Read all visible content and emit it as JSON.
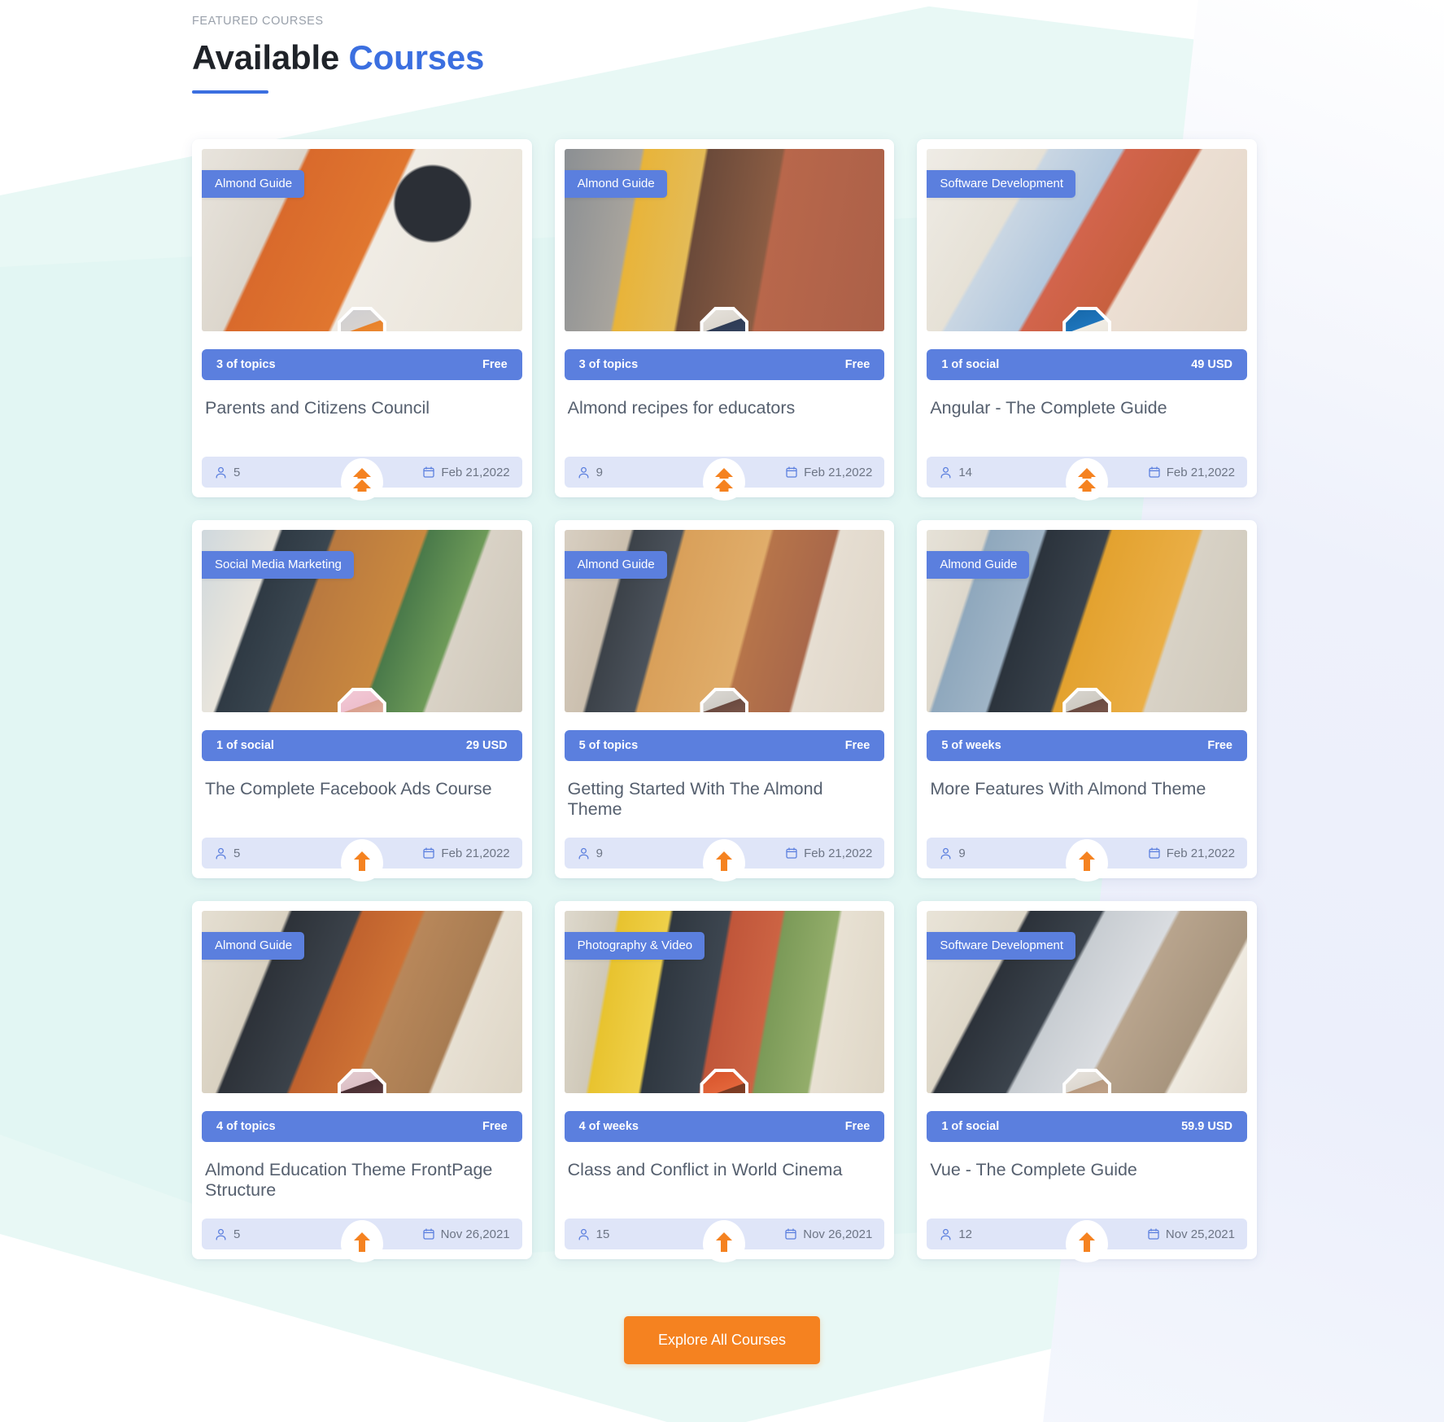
{
  "header": {
    "eyebrow": "FEATURED COURSES",
    "title_plain": "Available ",
    "title_accent": "Courses"
  },
  "colors": {
    "accent_blue": "#3b6fe0",
    "badge_blue": "#5b7fde",
    "orange": "#f58220",
    "footer_bg": "#dfe5f8",
    "mint_bg": "#e4f7f3",
    "title_text": "#555f6e"
  },
  "cards": [
    {
      "category": "Almond Guide",
      "lessons": "3 of topics",
      "price": "Free",
      "title": "Parents and Citizens Council",
      "students": "5",
      "date": "Feb 21,2022",
      "photo_class": "ph-1",
      "avatar_class": "av-1",
      "level_icon": "double-arrow-up-icon"
    },
    {
      "category": "Almond Guide",
      "lessons": "3 of topics",
      "price": "Free",
      "title": "Almond recipes for educators",
      "students": "9",
      "date": "Feb 21,2022",
      "photo_class": "ph-2",
      "avatar_class": "av-2",
      "level_icon": "double-arrow-up-icon"
    },
    {
      "category": "Software Development",
      "lessons": "1 of social",
      "price": "49 USD",
      "title": "Angular - The Complete Guide",
      "students": "14",
      "date": "Feb 21,2022",
      "photo_class": "ph-3",
      "avatar_class": "av-3",
      "level_icon": "double-arrow-up-icon"
    },
    {
      "category": "Social Media Marketing",
      "lessons": "1 of social",
      "price": "29 USD",
      "title": "The Complete Facebook Ads Course",
      "students": "5",
      "date": "Feb 21,2022",
      "photo_class": "ph-4",
      "avatar_class": "av-4",
      "level_icon": "arrow-up-icon"
    },
    {
      "category": "Almond Guide",
      "lessons": "5 of topics",
      "price": "Free",
      "title": "Getting Started With The Almond Theme",
      "students": "9",
      "date": "Feb 21,2022",
      "photo_class": "ph-5",
      "avatar_class": "av-5",
      "level_icon": "arrow-up-icon"
    },
    {
      "category": "Almond Guide",
      "lessons": "5 of weeks",
      "price": "Free",
      "title": "More Features With Almond Theme",
      "students": "9",
      "date": "Feb 21,2022",
      "photo_class": "ph-6",
      "avatar_class": "av-6",
      "level_icon": "arrow-up-icon"
    },
    {
      "category": "Almond Guide",
      "lessons": "4 of topics",
      "price": "Free",
      "title": "Almond Education Theme FrontPage Structure",
      "students": "5",
      "date": "Nov 26,2021",
      "photo_class": "ph-7",
      "avatar_class": "av-7",
      "level_icon": "arrow-up-icon"
    },
    {
      "category": "Photography & Video",
      "lessons": "4 of weeks",
      "price": "Free",
      "title": "Class and Conflict in World Cinema",
      "students": "15",
      "date": "Nov 26,2021",
      "photo_class": "ph-8",
      "avatar_class": "av-8",
      "level_icon": "arrow-up-icon"
    },
    {
      "category": "Software Development",
      "lessons": "1 of social",
      "price": "59.9 USD",
      "title": "Vue - The Complete Guide",
      "students": "12",
      "date": "Nov 25,2021",
      "photo_class": "ph-9",
      "avatar_class": "av-9",
      "level_icon": "arrow-up-icon"
    }
  ],
  "cta": {
    "label": "Explore All Courses"
  },
  "icons": {
    "student": "user-icon",
    "date": "calendar-icon"
  }
}
